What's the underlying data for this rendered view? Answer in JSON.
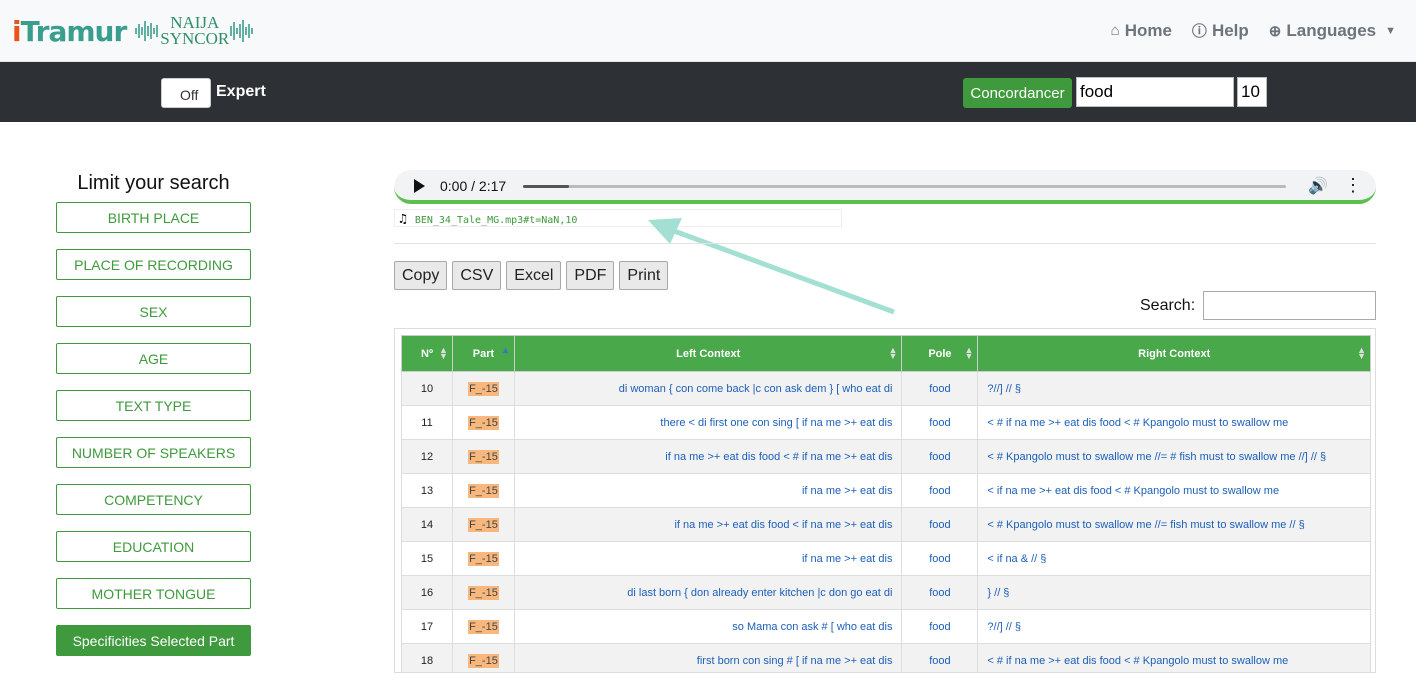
{
  "logo": {
    "itramur_a": "i",
    "itramur_b": "Tramur",
    "naija_line1": "NAIJA",
    "naija_line2": "SYNCOR"
  },
  "nav": {
    "home": "Home",
    "help": "Help",
    "languages": "Languages"
  },
  "toolbar": {
    "toggle_label": "Off",
    "expert_label": "Expert",
    "concordancer_label": "Concordancer",
    "query": "food",
    "context_size": "10"
  },
  "sidebar": {
    "title": "Limit your search",
    "filters": [
      "BIRTH PLACE",
      "PLACE OF RECORDING",
      "SEX",
      "AGE",
      "TEXT TYPE",
      "NUMBER OF SPEAKERS",
      "COMPETENCY",
      "EDUCATION",
      "MOTHER TONGUE"
    ],
    "active_button": "Specificities Selected Part"
  },
  "audio": {
    "time": "0:00 / 2:17",
    "progress": 0.06,
    "file": "BEN_34_Tale_MG.mp3#t=NaN,10"
  },
  "exports": [
    "Copy",
    "CSV",
    "Excel",
    "PDF",
    "Print"
  ],
  "search": {
    "label": "Search:"
  },
  "table": {
    "headers": [
      "Nº",
      "Part",
      "Left Context",
      "Pole",
      "Right Context"
    ],
    "rows": [
      {
        "n": "10",
        "part": "F_-15",
        "left": "di woman { con come back |c con ask dem } [ who eat di",
        "pole": "food",
        "right": "?//] // §"
      },
      {
        "n": "11",
        "part": "F_-15",
        "left": "there < di first one con sing [ if na me >+ eat dis",
        "pole": "food",
        "right": "< # if na me >+ eat dis food < # Kpangolo must to swallow me"
      },
      {
        "n": "12",
        "part": "F_-15",
        "left": "if na me >+ eat dis food < # if na me >+ eat dis",
        "pole": "food",
        "right": "< # Kpangolo must to swallow me //= # fish must to swallow me //] // §"
      },
      {
        "n": "13",
        "part": "F_-15",
        "left": "if na me >+ eat dis",
        "pole": "food",
        "right": "< if na me >+ eat dis food < # Kpangolo must to swallow me"
      },
      {
        "n": "14",
        "part": "F_-15",
        "left": "if na me >+ eat dis food < if na me >+ eat dis",
        "pole": "food",
        "right": "< # Kpangolo must to swallow me //= fish must to swallow me // §"
      },
      {
        "n": "15",
        "part": "F_-15",
        "left": "if na me >+ eat dis",
        "pole": "food",
        "right": "< if na & // §"
      },
      {
        "n": "16",
        "part": "F_-15",
        "left": "di last born { don already enter kitchen |c don go eat di",
        "pole": "food",
        "right": "} // §"
      },
      {
        "n": "17",
        "part": "F_-15",
        "left": "so Mama con ask # [ who eat dis",
        "pole": "food",
        "right": "?//] // §"
      },
      {
        "n": "18",
        "part": "F_-15",
        "left": "first born con sing # [ if na me >+ eat dis",
        "pole": "food",
        "right": "< # if na me >+ eat dis food < # Kpangolo must to swallow me"
      }
    ]
  }
}
